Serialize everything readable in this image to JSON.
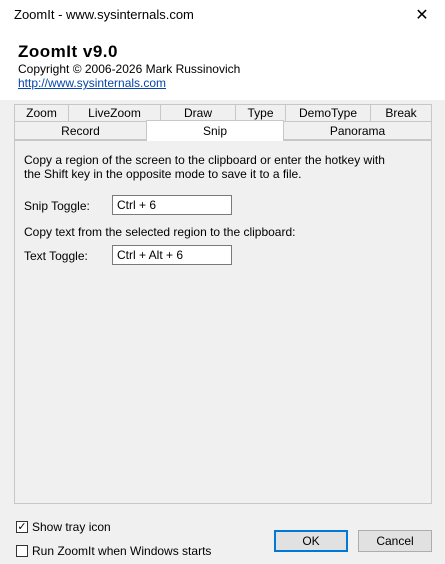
{
  "window": {
    "title": "ZoomIt - www.sysinternals.com",
    "close_glyph": "✕"
  },
  "header": {
    "app_name": "ZoomIt v9.0",
    "copyright": "Copyright © 2006-2026 Mark Russinovich",
    "website": "http://www.sysinternals.com"
  },
  "tabs_row1": [
    "Zoom",
    "LiveZoom",
    "Draw",
    "Type",
    "DemoType",
    "Break"
  ],
  "tabs_row2": [
    "Record",
    "Snip",
    "Panorama"
  ],
  "active_tab": "Snip",
  "snip": {
    "description": "Copy a region of the screen to the clipboard or enter the hotkey with the Shift key in the opposite mode to save it to a file.",
    "snip_toggle_label": "Snip Toggle:",
    "snip_toggle_value": "Ctrl + 6",
    "text_description": "Copy text from the selected region to the clipboard:",
    "text_toggle_label": "Text Toggle:",
    "text_toggle_value": "Ctrl + Alt + 6"
  },
  "options": {
    "show_tray_icon_label": "Show tray icon",
    "show_tray_icon_checked": true,
    "run_at_startup_label": "Run ZoomIt when Windows starts",
    "run_at_startup_checked": false
  },
  "buttons": {
    "ok": "OK",
    "cancel": "Cancel"
  },
  "colors": {
    "accent": "#0078d7",
    "link": "#0645ad"
  }
}
